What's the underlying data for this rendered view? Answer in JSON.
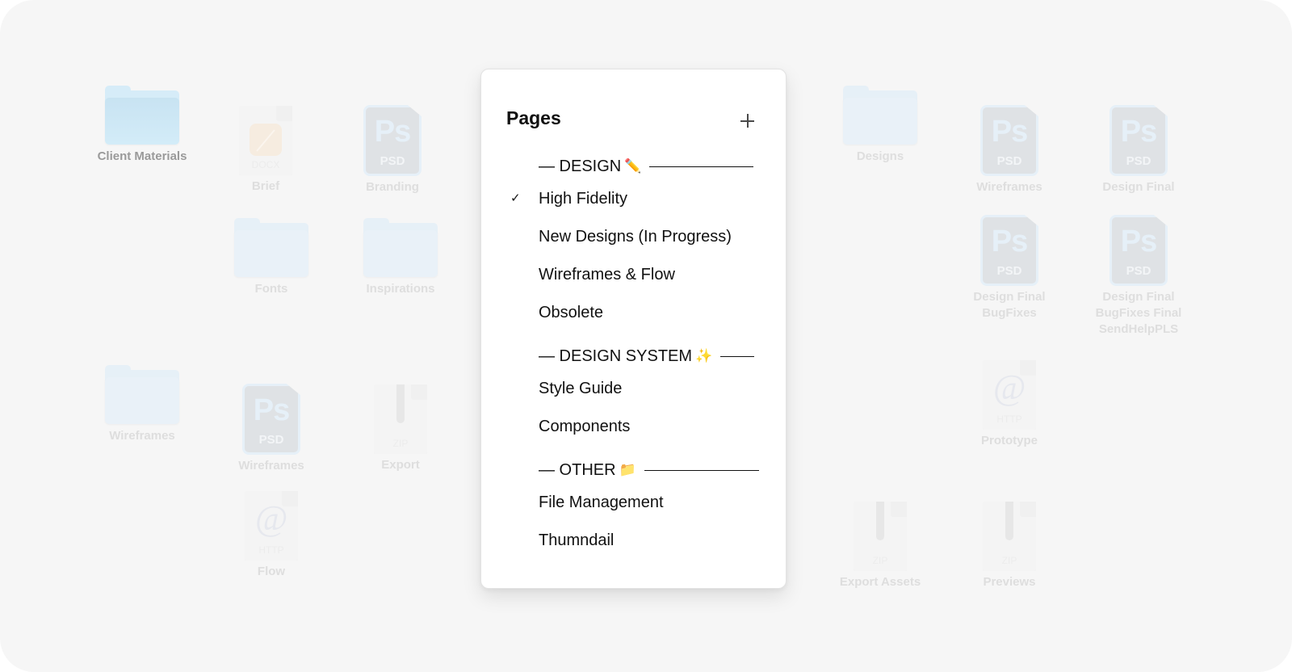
{
  "popup": {
    "title": "Pages",
    "add_icon": "plus-icon",
    "rows": [
      {
        "kind": "divider",
        "label": "— DESIGN",
        "emoji": "✏️"
      },
      {
        "kind": "page",
        "label": "High Fidelity",
        "selected": true,
        "check": "✓"
      },
      {
        "kind": "page",
        "label": "New Designs (In Progress)"
      },
      {
        "kind": "page",
        "label": "Wireframes & Flow"
      },
      {
        "kind": "page",
        "label": "Obsolete"
      },
      {
        "kind": "divider",
        "label": "— DESIGN SYSTEM",
        "emoji": "✨"
      },
      {
        "kind": "page",
        "label": "Style Guide"
      },
      {
        "kind": "page",
        "label": "Components"
      },
      {
        "kind": "divider",
        "label": "— OTHER",
        "emoji": "📁"
      },
      {
        "kind": "page",
        "label": "File Management"
      },
      {
        "kind": "page",
        "label": "Thumndail"
      }
    ]
  },
  "background_files": [
    {
      "name": "Client Materials",
      "type": "folder"
    },
    {
      "name": "Brief",
      "type": "docx",
      "ext": "DOCX"
    },
    {
      "name": "Branding",
      "type": "psd",
      "ext": "PSD",
      "glyph": "Ps"
    },
    {
      "name": "Fonts",
      "type": "folder"
    },
    {
      "name": "Inspirations",
      "type": "folder"
    },
    {
      "name": "Wireframes",
      "type": "folder"
    },
    {
      "name": "Wireframes",
      "type": "psd",
      "ext": "PSD",
      "glyph": "Ps"
    },
    {
      "name": "Export",
      "type": "zip",
      "ext": "ZIP"
    },
    {
      "name": "Flow",
      "type": "http",
      "ext": "HTTP",
      "glyph": "@"
    },
    {
      "name": "Designs",
      "type": "folder"
    },
    {
      "name": "Wireframes",
      "type": "psd",
      "ext": "PSD",
      "glyph": "Ps"
    },
    {
      "name": "Design Final",
      "type": "psd",
      "ext": "PSD",
      "glyph": "Ps"
    },
    {
      "name": "Design Final BugFixes",
      "type": "psd",
      "ext": "PSD",
      "glyph": "Ps"
    },
    {
      "name": "Design Final BugFixes Final SendHelpPLS",
      "type": "psd",
      "ext": "PSD",
      "glyph": "Ps"
    },
    {
      "name": "Prototype",
      "type": "http",
      "ext": "HTTP",
      "glyph": "@"
    },
    {
      "name": "Export Assets",
      "type": "zip",
      "ext": "ZIP"
    },
    {
      "name": "Previews",
      "type": "zip",
      "ext": "ZIP"
    }
  ]
}
